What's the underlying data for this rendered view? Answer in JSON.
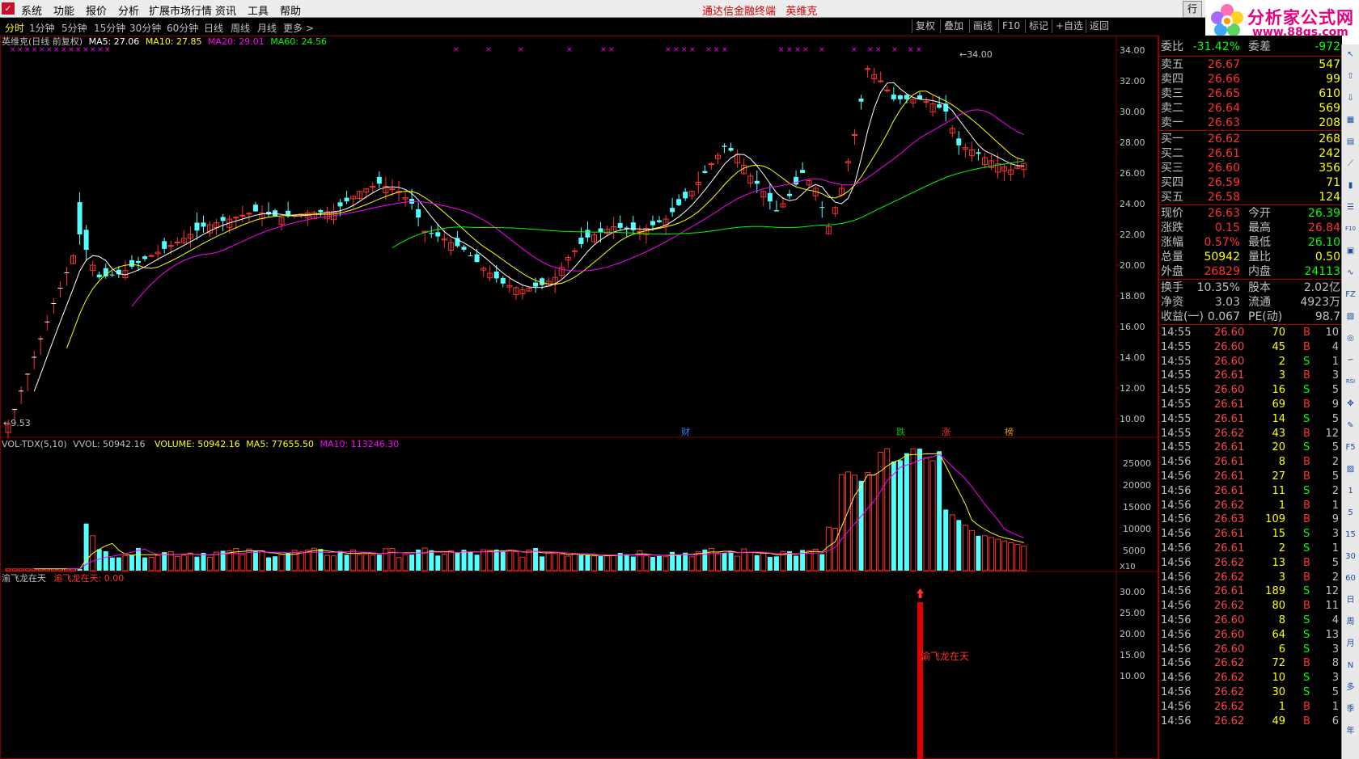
{
  "menubar": {
    "items": [
      "系统",
      "功能",
      "报价",
      "分析",
      "扩展市场行情",
      "资讯",
      "工具",
      "帮助"
    ],
    "center_title": "通达信金融终端",
    "stock_name": "英维克",
    "window_btn": "行"
  },
  "brand": {
    "title": "分析家公式网",
    "url": "www.88gs.com"
  },
  "tabs": [
    "分时",
    "1分钟",
    "5分钟",
    "15分钟",
    "30分钟",
    "60分钟",
    "日线",
    "周线",
    "月线",
    "更多 >"
  ],
  "right_buttons": [
    "复权",
    "叠加",
    "画线",
    "F10",
    "标记",
    "+自选",
    "返回"
  ],
  "price_panel": {
    "title": "英维克(日线 前复权)",
    "ma5": "MA5: 27.06",
    "ma10": "MA10: 27.85",
    "ma20": "MA20: 29.01",
    "ma60": "MA60: 24.56",
    "high_label": "34.00",
    "low_label": "9.53",
    "y_ticks": [
      "34.00",
      "32.00",
      "30.00",
      "28.00",
      "26.00",
      "24.00",
      "22.00",
      "20.00",
      "18.00",
      "16.00",
      "14.00",
      "12.00",
      "10.00"
    ],
    "markers": [
      {
        "text": "财",
        "color": "#3a7fff"
      },
      {
        "text": "跌",
        "color": "#00c000"
      },
      {
        "text": "涨",
        "color": "#ff3030"
      },
      {
        "text": "榜",
        "color": "#e0a000"
      }
    ]
  },
  "volume_panel": {
    "title": "VOL-TDX(5,10)",
    "vvol": "VVOL: 50942.16",
    "volume": "VOLUME: 50942.16",
    "ma5": "MA5: 77655.50",
    "ma10": "MA10: 113246.30",
    "y_ticks": [
      "25000",
      "20000",
      "15000",
      "10000",
      "5000"
    ],
    "unit": "X10"
  },
  "indicator_panel": {
    "title": "渝飞龙在天",
    "value_label": "渝飞龙在天: 0.00",
    "signal_text": "渝飞龙在天",
    "y_ticks": [
      "30.00",
      "25.00",
      "20.00",
      "15.00",
      "10.00"
    ]
  },
  "colors": {
    "up": "#ff3232",
    "down": "#54ffff",
    "ma5": "#ffffff",
    "ma10": "#ffff00",
    "ma20": "#ff00ff",
    "ma60": "#00ff00",
    "grid": "#800000"
  },
  "chart_data": {
    "type": "candlestick",
    "y_range": [
      9.53,
      34.0
    ],
    "candles": [
      [
        26.2,
        26.68,
        26.12,
        26.62
      ],
      [
        26.62,
        26.85,
        26.4,
        26.45
      ],
      [
        26.45,
        26.6,
        25.9,
        26.02
      ],
      [
        26.02,
        26.3,
        25.7,
        26.2
      ],
      [
        26.2,
        26.7,
        26.1,
        26.55
      ],
      [
        26.55,
        26.95,
        26.3,
        26.4
      ],
      [
        26.4,
        26.7,
        26.0,
        26.1
      ],
      [
        26.1,
        26.5,
        25.9,
        26.38
      ],
      [
        26.38,
        26.8,
        26.2,
        26.6
      ],
      [
        26.6,
        26.84,
        26.1,
        26.63
      ]
    ],
    "volume_ticks": [
      25000,
      20000,
      15000,
      10000,
      5000
    ],
    "indicator_signal": 30
  },
  "quote": {
    "weibi_label": "委比",
    "weibi": "-31.42%",
    "weicha_label": "委差",
    "weicha": "-972",
    "sells": [
      {
        "label": "卖五",
        "price": "26.67",
        "vol": "547"
      },
      {
        "label": "卖四",
        "price": "26.66",
        "vol": "99"
      },
      {
        "label": "卖三",
        "price": "26.65",
        "vol": "610"
      },
      {
        "label": "卖二",
        "price": "26.64",
        "vol": "569"
      },
      {
        "label": "卖一",
        "price": "26.63",
        "vol": "208"
      }
    ],
    "buys": [
      {
        "label": "买一",
        "price": "26.62",
        "vol": "268"
      },
      {
        "label": "买二",
        "price": "26.61",
        "vol": "242"
      },
      {
        "label": "买三",
        "price": "26.60",
        "vol": "356"
      },
      {
        "label": "买四",
        "price": "26.59",
        "vol": "71"
      },
      {
        "label": "买五",
        "price": "26.58",
        "vol": "124"
      }
    ],
    "stats": [
      {
        "l1": "现价",
        "v1": "26.63",
        "c1": "#ff3232",
        "l2": "今开",
        "v2": "26.39",
        "c2": "#00ff00"
      },
      {
        "l1": "涨跌",
        "v1": "0.15",
        "c1": "#ff3232",
        "l2": "最高",
        "v2": "26.84",
        "c2": "#ff3232"
      },
      {
        "l1": "涨幅",
        "v1": "0.57%",
        "c1": "#ff3232",
        "l2": "最低",
        "v2": "26.10",
        "c2": "#00ff00"
      },
      {
        "l1": "总量",
        "v1": "50942",
        "c1": "#ffff00",
        "l2": "量比",
        "v2": "0.50",
        "c2": "#ffff00"
      },
      {
        "l1": "外盘",
        "v1": "26829",
        "c1": "#ff3232",
        "l2": "内盘",
        "v2": "24113",
        "c2": "#00ff00"
      }
    ],
    "stats2": [
      {
        "l1": "换手",
        "v1": "10.35%",
        "l2": "股本",
        "v2": "2.02亿"
      },
      {
        "l1": "净资",
        "v1": "3.03",
        "l2": "流通",
        "v2": "4923万"
      },
      {
        "l1": "收益(一)",
        "v1": "0.067",
        "l2": "PE(动)",
        "v2": "98.7"
      }
    ]
  },
  "ticks": [
    [
      "14:55",
      "26.60",
      "70",
      "B",
      "10"
    ],
    [
      "14:55",
      "26.60",
      "45",
      "B",
      "4"
    ],
    [
      "14:55",
      "26.60",
      "2",
      "S",
      "1"
    ],
    [
      "14:55",
      "26.61",
      "3",
      "B",
      "3"
    ],
    [
      "14:55",
      "26.60",
      "16",
      "S",
      "5"
    ],
    [
      "14:55",
      "26.61",
      "69",
      "B",
      "9"
    ],
    [
      "14:55",
      "26.61",
      "14",
      "S",
      "5"
    ],
    [
      "14:55",
      "26.62",
      "43",
      "B",
      "12"
    ],
    [
      "14:55",
      "26.61",
      "20",
      "S",
      "5"
    ],
    [
      "14:56",
      "26.61",
      "8",
      "B",
      "2"
    ],
    [
      "14:56",
      "26.61",
      "27",
      "B",
      "5"
    ],
    [
      "14:56",
      "26.61",
      "11",
      "S",
      "2"
    ],
    [
      "14:56",
      "26.62",
      "1",
      "B",
      "1"
    ],
    [
      "14:56",
      "26.63",
      "109",
      "B",
      "9"
    ],
    [
      "14:56",
      "26.61",
      "15",
      "S",
      "3"
    ],
    [
      "14:56",
      "26.61",
      "2",
      "S",
      "1"
    ],
    [
      "14:56",
      "26.62",
      "13",
      "B",
      "5"
    ],
    [
      "14:56",
      "26.62",
      "3",
      "B",
      "2"
    ],
    [
      "14:56",
      "26.61",
      "189",
      "S",
      "12"
    ],
    [
      "14:56",
      "26.62",
      "80",
      "B",
      "11"
    ],
    [
      "14:56",
      "26.60",
      "8",
      "S",
      "4"
    ],
    [
      "14:56",
      "26.60",
      "64",
      "S",
      "13"
    ],
    [
      "14:56",
      "26.60",
      "6",
      "S",
      "3"
    ],
    [
      "14:56",
      "26.62",
      "72",
      "B",
      "8"
    ],
    [
      "14:56",
      "26.62",
      "10",
      "S",
      "3"
    ],
    [
      "14:56",
      "26.62",
      "30",
      "S",
      "5"
    ],
    [
      "14:56",
      "26.62",
      "1",
      "B",
      "1"
    ],
    [
      "14:56",
      "26.62",
      "49",
      "B",
      "6"
    ]
  ],
  "toolbar_icons": [
    "cursor-icon",
    "up-icon",
    "down-icon",
    "grid-icon",
    "table-icon",
    "line-icon",
    "bar-icon",
    "list-icon",
    "f10-icon",
    "board-icon",
    "wave-icon",
    "fz-icon",
    "chart-icon",
    "circle-icon",
    "curve-icon",
    "rsi-icon",
    "move-icon",
    "pen-icon",
    "f5-icon",
    "img-icon",
    "1",
    "5",
    "15",
    "30",
    "60",
    "日",
    "周",
    "月",
    "N",
    "多",
    "季",
    "年"
  ]
}
